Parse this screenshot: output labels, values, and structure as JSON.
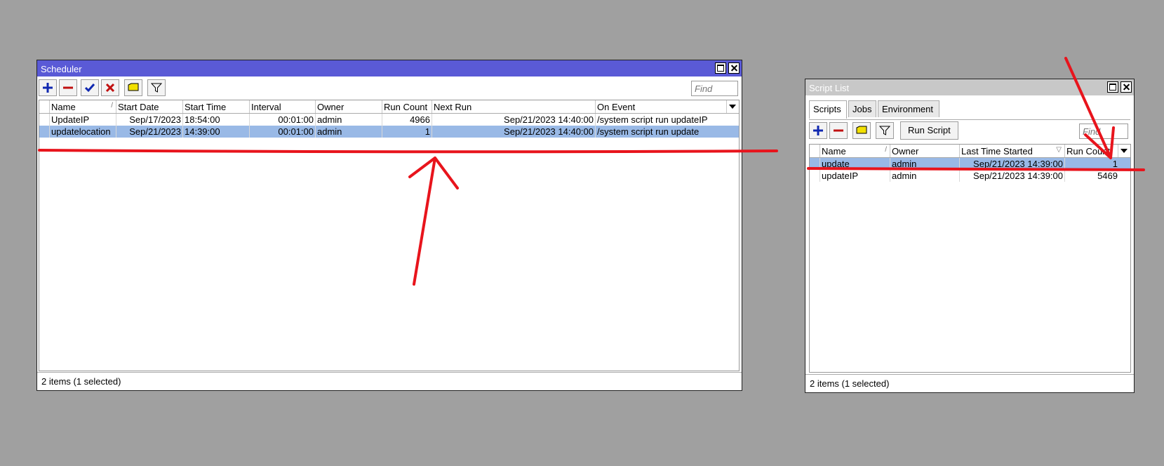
{
  "scheduler": {
    "title": "Scheduler",
    "find_placeholder": "Find",
    "columns": [
      "Name",
      "Start Date",
      "Start Time",
      "Interval",
      "Owner",
      "Run Count",
      "Next Run",
      "On Event"
    ],
    "rows": [
      {
        "name": "UpdateIP",
        "start_date": "Sep/17/2023",
        "start_time": "18:54:00",
        "interval": "00:01:00",
        "owner": "admin",
        "run_count": "4966",
        "next_run": "Sep/21/2023 14:40:00",
        "on_event": "/system script run updateIP"
      },
      {
        "name": "updatelocation",
        "start_date": "Sep/21/2023",
        "start_time": "14:39:00",
        "interval": "00:01:00",
        "owner": "admin",
        "run_count": "1",
        "next_run": "Sep/21/2023 14:40:00",
        "on_event": "/system script run update"
      }
    ],
    "status": "2 items (1 selected)"
  },
  "script_list": {
    "title": "Script List",
    "tabs": [
      "Scripts",
      "Jobs",
      "Environment"
    ],
    "run_script_label": "Run Script",
    "find_placeholder": "Find",
    "columns": [
      "Name",
      "Owner",
      "Last Time Started",
      "Run Count"
    ],
    "rows": [
      {
        "name": "update",
        "owner": "admin",
        "last_started": "Sep/21/2023 14:39:00",
        "run_count": "1"
      },
      {
        "name": "updateIP",
        "owner": "admin",
        "last_started": "Sep/21/2023 14:39:00",
        "run_count": "5469"
      }
    ],
    "status": "2 items (1 selected)"
  },
  "colors": {
    "desktop": "#a0a0a0",
    "active_titlebar": "#5a5ad6",
    "inactive_titlebar": "#c8c8c8",
    "selection": "#99b9e6",
    "annotation": "#e8141c"
  },
  "icons": [
    "add-icon",
    "remove-icon",
    "enable-icon",
    "disable-icon",
    "comment-icon",
    "filter-icon",
    "maximize-icon",
    "close-icon"
  ]
}
